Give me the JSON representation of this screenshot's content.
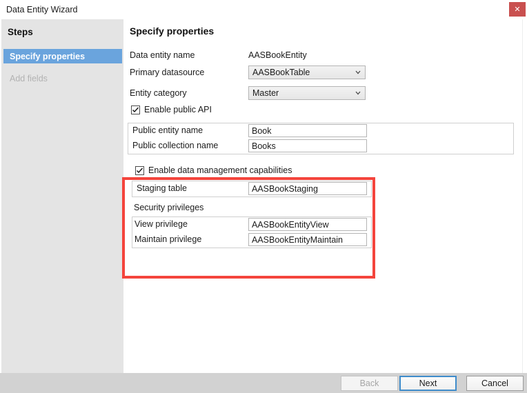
{
  "window": {
    "title": "Data Entity Wizard",
    "close_label": "✕",
    "close_icon": "close-icon",
    "close_color": "#c9504f"
  },
  "sidebar": {
    "title": "Steps",
    "selected_color": "#6aa4dd",
    "items": [
      {
        "label": "Specify properties",
        "state": "selected"
      },
      {
        "label": "Add fields",
        "state": "disabled"
      }
    ]
  },
  "content": {
    "title": "Specify properties",
    "fields": {
      "data_entity_name": {
        "label": "Data entity name",
        "value": "AASBookEntity"
      },
      "primary_datasource": {
        "label": "Primary datasource",
        "value": "AASBookTable",
        "icon": "chevron-down-icon"
      },
      "entity_category": {
        "label": "Entity category",
        "value": "Master",
        "icon": "chevron-down-icon"
      },
      "enable_public_api": {
        "label": "Enable public API",
        "checked": true
      },
      "public_entity_name": {
        "label": "Public entity name",
        "value": "Book"
      },
      "public_collection_name": {
        "label": "Public collection name",
        "value": "Books"
      },
      "enable_data_management": {
        "label": "Enable data management capabilities",
        "checked": true
      },
      "staging_table": {
        "label": "Staging table",
        "value": "AASBookStaging"
      },
      "security_privileges_header": {
        "label": "Security privileges"
      },
      "view_privilege": {
        "label": "View privilege",
        "value": "AASBookEntityView"
      },
      "maintain_privilege": {
        "label": "Maintain privilege",
        "value": "AASBookEntityMaintain"
      }
    }
  },
  "highlight": {
    "color": "#f4443c"
  },
  "footer": {
    "back_label": "Back",
    "next_label": "Next",
    "cancel_label": "Cancel"
  }
}
